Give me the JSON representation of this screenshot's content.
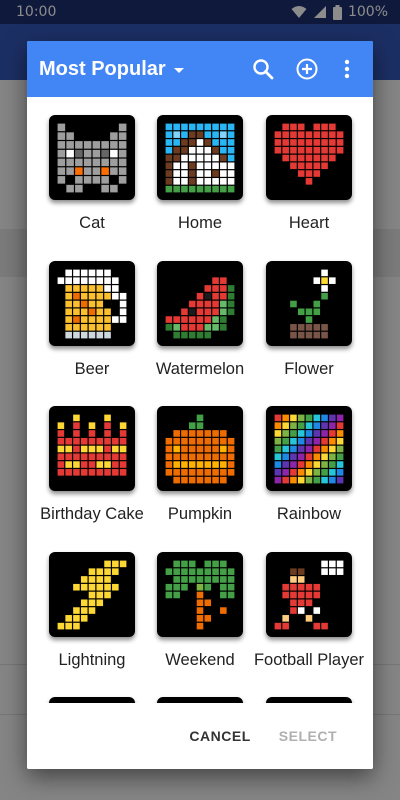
{
  "status": {
    "time": "10:00",
    "battery": "100%"
  },
  "dialog": {
    "title": "Most Popular",
    "cancel": "CANCEL",
    "select": "SELECT"
  },
  "tiles": [
    {
      "label": "Cat",
      "icon": "cat-icon"
    },
    {
      "label": "Home",
      "icon": "home-icon"
    },
    {
      "label": "Heart",
      "icon": "heart-icon"
    },
    {
      "label": "Beer",
      "icon": "beer-icon"
    },
    {
      "label": "Watermelon",
      "icon": "watermelon-icon"
    },
    {
      "label": "Flower",
      "icon": "flower-icon"
    },
    {
      "label": "Birthday Cake",
      "icon": "birthday-cake-icon"
    },
    {
      "label": "Pumpkin",
      "icon": "pumpkin-icon"
    },
    {
      "label": "Rainbow",
      "icon": "rainbow-icon"
    },
    {
      "label": "Lightning",
      "icon": "lightning-icon"
    },
    {
      "label": "Weekend",
      "icon": "weekend-icon"
    },
    {
      "label": "Football Player",
      "icon": "football-player-icon"
    },
    {
      "label": "",
      "icon": "partial-icon"
    },
    {
      "label": "",
      "icon": "partial-icon"
    },
    {
      "label": "",
      "icon": "partial-icon"
    }
  ],
  "colors": {
    "header": "#4285f4",
    "statusbar": "#1a2f6e"
  }
}
